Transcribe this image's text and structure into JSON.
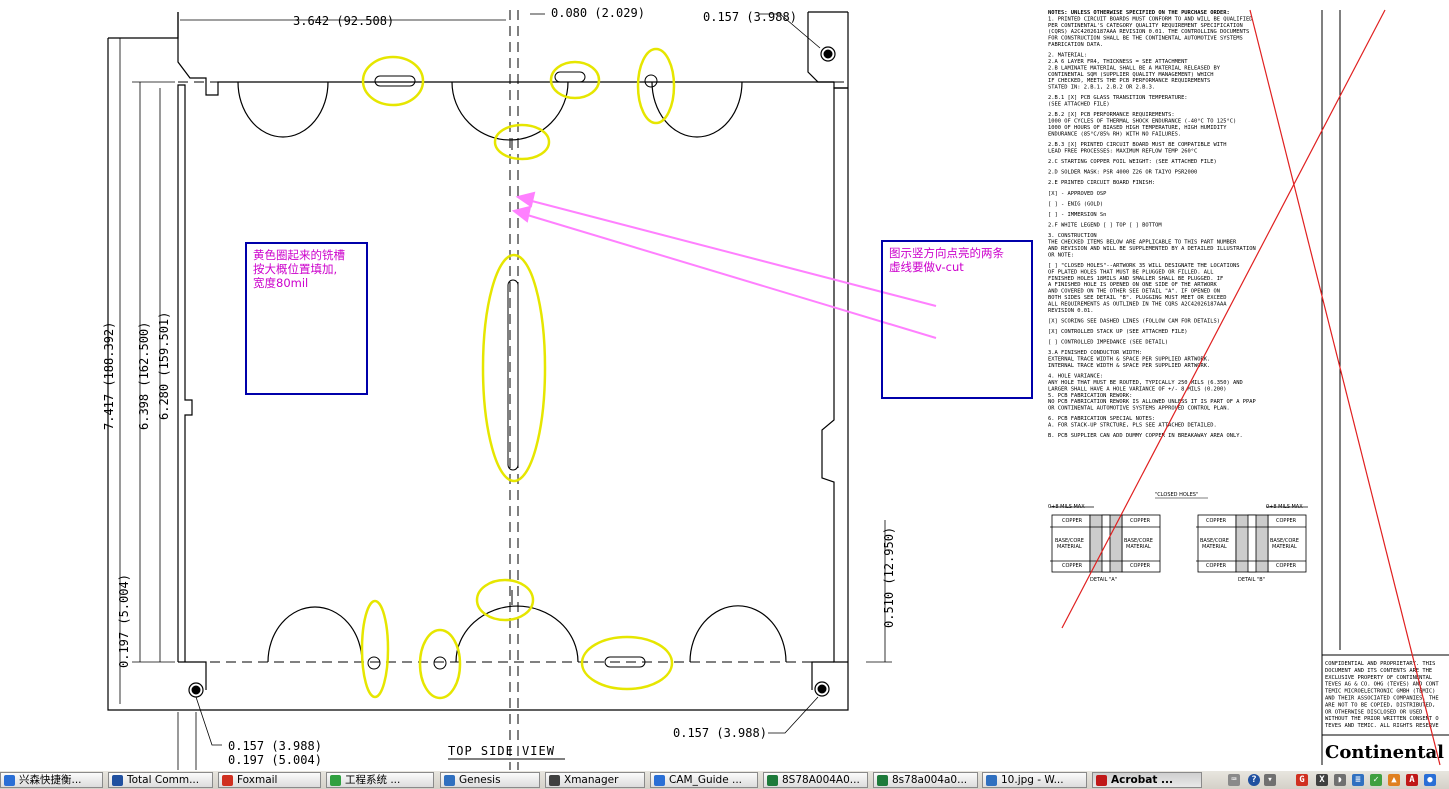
{
  "drawing": {
    "dims": {
      "top_width": "3.642 (92.508)",
      "top_offset": "0.080 (2.029)",
      "top_right_hole": "0.157 (3.988)",
      "left_total": "7.417 (188.392)",
      "left_mid": "6.398 (162.500)",
      "left_inner": "6.280 (159.501)",
      "left_bottom": "0.197 (5.004)",
      "right_bottom": "0.510 (12.950)",
      "bl_hole": "0.157 (3.988)",
      "bl_offset": "0.197 (5.004)",
      "br_hole": "0.157 (3.988)"
    },
    "view_label": "TOP SIDE VIEW",
    "colors": {
      "highlight": "#e6e600",
      "annot_border": "#0000aa",
      "annot_text": "#cc00cc",
      "arrow": "#ff80ff",
      "cross": "#e02020"
    }
  },
  "annotations": {
    "left": [
      "黄色圈起来的铣槽",
      "按大概位置填加,",
      "宽度80mil"
    ],
    "right": [
      "图示竖方向点亮的两条",
      "虚线要做v-cut"
    ]
  },
  "notes": [
    {
      "t": "NOTES: UNLESS OTHERWISE SPECIFIED ON THE PURCHASE ORDER:",
      "b": true
    },
    {
      "t": "1. PRINTED CIRCUIT BOARDS MUST CONFORM TO AND WILL BE QUALIFIED"
    },
    {
      "t": "   PER CONTINENTAL'S CATEGORY QUALITY REQUIREMENT SPECIFICATION"
    },
    {
      "t": "   (CQRS) A2C42026187AAA REVISION 0.01. THE CONTROLLING DOCUMENTS"
    },
    {
      "t": "   FOR CONSTRUCTION SHALL BE THE CONTINENTAL AUTOMOTIVE SYSTEMS"
    },
    {
      "t": "   FABRICATION DATA."
    },
    {
      "t": ""
    },
    {
      "t": "2. MATERIAL:"
    },
    {
      "t": "  2.A 6 LAYER FR4, THICKNESS = SEE ATTACHMENT"
    },
    {
      "t": "  2.B LAMINATE MATERIAL SHALL BE A MATERIAL RELEASED BY"
    },
    {
      "t": "      CONTINENTAL SQM (SUPPLIER QUALITY MANAGEMENT) WHICH"
    },
    {
      "t": "      IF CHECKED, MEETS THE PCB PERFORMANCE REQUIREMENTS"
    },
    {
      "t": "      STATED IN: 2.B.1, 2.B.2 OR 2.B.3."
    },
    {
      "t": ""
    },
    {
      "t": "  2.B.1 [X] PCB GLASS TRANSITION TEMPERATURE:"
    },
    {
      "t": "        (SEE ATTACHED FILE)"
    },
    {
      "t": ""
    },
    {
      "t": "  2.B.2 [X] PCB PERFORMANCE REQUIREMENTS:"
    },
    {
      "t": "        1000 OF CYCLES OF THERMAL SHOCK ENDURANCE (-40°C TO 125°C)"
    },
    {
      "t": "        1000 OF HOURS OF BIASED HIGH TEMPERATURE, HIGH HUMIDITY"
    },
    {
      "t": "        ENDURANCE (85°C/85% RH) WITH NO FAILURES."
    },
    {
      "t": ""
    },
    {
      "t": "  2.B.3 [X] PRINTED CIRCUIT BOARD MUST BE COMPATIBLE WITH"
    },
    {
      "t": "        LEAD FREE PROCESSES: MAXIMUM REFLOW TEMP 260°C"
    },
    {
      "t": ""
    },
    {
      "t": "  2.C STARTING COPPER FOIL WEIGHT: (SEE ATTACHED FILE)"
    },
    {
      "t": ""
    },
    {
      "t": "  2.D SOLDER MASK: PSR 4000 Z26 OR TAIYO PSR2000"
    },
    {
      "t": ""
    },
    {
      "t": "  2.E PRINTED CIRCUIT BOARD FINISH:"
    },
    {
      "t": ""
    },
    {
      "t": "      [X] -    APPROVED OSP"
    },
    {
      "t": ""
    },
    {
      "t": "      [ ] -    ENIG (GOLD)"
    },
    {
      "t": ""
    },
    {
      "t": "      [ ] -    IMMERSION Sn"
    },
    {
      "t": ""
    },
    {
      "t": "  2.F WHITE LEGEND [ ] TOP  [ ] BOTTOM"
    },
    {
      "t": ""
    },
    {
      "t": "3. CONSTRUCTION"
    },
    {
      "t": "   THE CHECKED ITEMS BELOW ARE APPLICABLE TO THIS PART NUMBER"
    },
    {
      "t": "   AND REVISION AND WILL BE SUPPLEMENTED BY A DETAILED ILLUSTRATION"
    },
    {
      "t": "   OR NOTE:"
    },
    {
      "t": ""
    },
    {
      "t": "   [ ] \"CLOSED HOLES\"--ARTWORK 35 WILL DESIGNATE THE LOCATIONS"
    },
    {
      "t": "       OF PLATED HOLES THAT MUST BE PLUGGED OR FILLED. ALL"
    },
    {
      "t": "       FINISHED HOLES 18MILS AND SMALLER SHALL BE PLUGGED. IF"
    },
    {
      "t": "       A FINISHED HOLE IS OPENED ON ONE SIDE OF THE ARTWORK"
    },
    {
      "t": "       AND COVERED ON THE OTHER SEE DETAIL \"A\". IF OPENED ON"
    },
    {
      "t": "       BOTH SIDES SEE DETAIL \"B\". PLUGGING MUST MEET OR EXCEED"
    },
    {
      "t": "       ALL REQUIREMENTS AS OUTLINED IN THE CQRS A2C42026187AAA"
    },
    {
      "t": "       REVISION 0.01."
    },
    {
      "t": ""
    },
    {
      "t": "   [X] SCORING SEE DASHED LINES (FOLLOW CAM FOR DETAILS)"
    },
    {
      "t": ""
    },
    {
      "t": "   [X] CONTROLLED STACK UP (SEE ATTACHED FILE)"
    },
    {
      "t": ""
    },
    {
      "t": "   [ ] CONTROLLED IMPEDANCE (SEE DETAIL)"
    },
    {
      "t": ""
    },
    {
      "t": "  3.A FINISHED CONDUCTOR WIDTH:"
    },
    {
      "t": "      EXTERNAL TRACE WIDTH & SPACE PER SUPPLIED ARTWORK."
    },
    {
      "t": "      INTERNAL TRACE WIDTH & SPACE PER SUPPLIED ARTWORK."
    },
    {
      "t": ""
    },
    {
      "t": "4. HOLE VARIANCE:"
    },
    {
      "t": "   ANY HOLE THAT MUST BE ROUTED, TYPICALLY 250 MILS (6.350) AND"
    },
    {
      "t": "   LARGER SHALL HAVE A HOLE VARIANCE OF +/- 8 MILS (0.200)"
    },
    {
      "t": "5. PCB FABRICATION REWORK:"
    },
    {
      "t": "   NO PCB FABRICATION REWORK IS ALLOWED UNLESS IT IS PART OF A PPAP"
    },
    {
      "t": "   OR CONTINENTAL AUTOMOTIVE SYSTEMS APPROVED CONTROL PLAN."
    },
    {
      "t": ""
    },
    {
      "t": "6. PCB FABRICATION SPECIAL NOTES:"
    },
    {
      "t": "   A. FOR STACK-UP STRCTURE, PLS SEE ATTACHED DETAILED."
    },
    {
      "t": ""
    },
    {
      "t": "   B. PCB SUPPLIER CAN ADD DUMMY COPPER IN BREAKAWAY AREA ONLY."
    }
  ],
  "details": {
    "closed_holes": "\"CLOSED HOLES\"",
    "mils_max_a": "0+8 MILS MAX",
    "mils_max_b": "0+8 MILS MAX",
    "copper": "COPPER",
    "base_core": "BASE/CORE",
    "material": "MATERIAL",
    "detail_a": "DETAIL \"A\"",
    "detail_b": "DETAIL \"B\""
  },
  "titleblock": {
    "lines": [
      "CONFIDENTIAL AND PROPRIETARY. THIS",
      "DOCUMENT AND ITS CONTENTS ARE THE",
      "EXCLUSIVE PROPERTY OF CONTINENTAL",
      "TEVES AG & CO. OHG (TEVES) AND CONT",
      "TEMIC MICROELECTRONIC GMBH (TEMIC)",
      "AND THEIR ASSOCIATED COMPANIES. THE",
      "ARE NOT TO BE COPIED, DISTRIBUTED,",
      "OR OTHERWISE DISCLOSED OR USED",
      "WITHOUT THE PRIOR WRITTEN CONSENT O",
      "TEVES AND TEMIC. ALL RIGHTS RESERVE"
    ],
    "logo": "Continental"
  },
  "taskbar": {
    "items": [
      {
        "label": "兴森快捷衡...",
        "icon": "app-icon",
        "color": "#2a6fd6"
      },
      {
        "label": "Total Comm...",
        "icon": "floppy-icon",
        "color": "#2050a0"
      },
      {
        "label": "Foxmail",
        "icon": "foxmail-icon",
        "color": "#d03020"
      },
      {
        "label": "工程系统  ...",
        "icon": "app-icon",
        "color": "#30a040"
      },
      {
        "label": "Genesis",
        "icon": "genesis-icon",
        "color": "#3070c0"
      },
      {
        "label": "Xmanager",
        "icon": "x-icon",
        "color": "#404040"
      },
      {
        "label": "CAM_Guide ...",
        "icon": "folder-icon",
        "color": "#2a6fd6"
      },
      {
        "label": "8S78A004A0...",
        "icon": "excel-icon",
        "color": "#1d7a3a"
      },
      {
        "label": "8s78a004a0...",
        "icon": "excel-icon",
        "color": "#1d7a3a"
      },
      {
        "label": "10.jpg - W...",
        "icon": "image-icon",
        "color": "#3070c0"
      },
      {
        "label": "Acrobat ...",
        "icon": "acrobat-icon",
        "color": "#c01818"
      }
    ]
  }
}
